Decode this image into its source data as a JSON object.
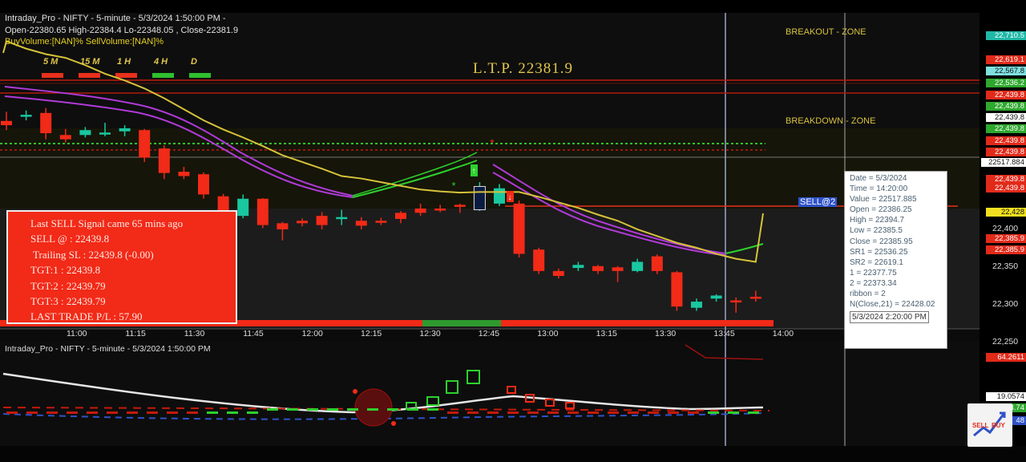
{
  "header": {
    "line1": "Intraday_Pro - NIFTY - 5-minute - 5/3/2024 1:50:00 PM -",
    "line2": "Open-22380.65  High-22384.4  Lo-22348.05 , Close-22381.9",
    "line3": "BuyVolume:[NAN]%   SellVolume:[NAN]%"
  },
  "ltp_text": "L.T.P. 22381.9",
  "zones": {
    "breakout": "BREAKOUT - ZONE",
    "breakdown": "BREAKDOWN - ZONE"
  },
  "sell_marker": "SELL@2",
  "timeframes": [
    {
      "label": "5 M",
      "color": "#e8301c"
    },
    {
      "label": "15 M",
      "color": "#e8301c"
    },
    {
      "label": "1 H",
      "color": "#e8301c"
    },
    {
      "label": "4 H",
      "color": "#2ec02e"
    },
    {
      "label": "D",
      "color": "#2ec02e"
    }
  ],
  "signal_box": {
    "line1": "Last SELL Signal came 65 mins ago",
    "line2": "SELL @ : 22439.8",
    "line3": "Trailing SL : 22439.8 (-0.00)",
    "line4": "TGT:1 : 22439.8",
    "line5": "TGT:2 : 22439.79",
    "line6": "TGT:3 : 22439.79",
    "line7": "LAST TRADE P/L : 57.90"
  },
  "tooltip": {
    "lines": [
      "Date = 5/3/2024",
      "Time = 14:20:00",
      "Value = 22517.885",
      "Open = 22386.25",
      "High = 22394.7",
      "Low = 22385.5",
      "Close = 22385.95",
      "SR1 = 22536.25",
      "SR2 = 22619.1",
      "1 = 22377.75",
      "2 = 22373.34",
      "ribbon = 2",
      "N(Close,21) = 22428.02"
    ],
    "footer": "5/3/2024 2:20:00 PM"
  },
  "price_tags": [
    {
      "text": "22,710.5",
      "color": "#1fb8a8"
    },
    {
      "text": "22,619.1",
      "color": "#e22a1a"
    },
    {
      "text": "22,567.8",
      "color": "#7fe0e0"
    },
    {
      "text": "22,536.2",
      "color": "#2ea82e"
    },
    {
      "text": "22,439.8",
      "color": "#e22a1a"
    },
    {
      "text": "22,439.8",
      "color": "#2ea82e"
    },
    {
      "text": "22,439.8",
      "color": "#ffffff"
    },
    {
      "text": "22,439.8",
      "color": "#2ea82e"
    },
    {
      "text": "22,439.8",
      "color": "#e22a1a"
    },
    {
      "text": "22,439.8",
      "color": "#e22a1a"
    },
    {
      "text": "22517.884",
      "color": "#ffffff"
    },
    {
      "text": "22,439.8",
      "color": "#e22a1a"
    },
    {
      "text": "22,439.8",
      "color": "#e22a1a"
    },
    {
      "text": "22,428",
      "color": "#f2e020"
    },
    {
      "text": "22,385.9",
      "color": "#e22a1a"
    },
    {
      "text": "22,385.9",
      "color": "#e22a1a"
    },
    {
      "text": "64.2611",
      "color": "#e22a1a"
    },
    {
      "text": "19.0574",
      "color": "#ffffff"
    },
    {
      "text": "18.74",
      "color": "#2ea82e"
    },
    {
      "text": "48",
      "color": "#2f52c8"
    }
  ],
  "y_axis_labels": [
    "22,400",
    "22,350",
    "22,300",
    "22,250"
  ],
  "indicator_header": "Intraday_Pro - NIFTY - 5-minute - 5/3/2024 1:50:00 PM",
  "colors": {
    "bull": "#19c7a0",
    "bear": "#f22a18",
    "ema": "#d6c23a",
    "ribbon_purple": "#b03ad8",
    "ribbon_green": "#2ed02e"
  },
  "chart_data": {
    "type": "candlestick",
    "categories": [
      "10:40",
      "10:45",
      "10:50",
      "10:55",
      "11:00",
      "11:05",
      "11:10",
      "11:15",
      "11:20",
      "11:25",
      "11:30",
      "11:35",
      "11:40",
      "11:45",
      "11:50",
      "11:55",
      "12:00",
      "12:05",
      "12:10",
      "12:15",
      "12:20",
      "12:25",
      "12:30",
      "12:35",
      "12:40",
      "12:45",
      "12:50",
      "12:55",
      "13:00",
      "13:05",
      "13:10",
      "13:15",
      "13:20",
      "13:25",
      "13:30",
      "13:35",
      "13:40",
      "13:45",
      "13:50"
    ],
    "x_ticks": [
      "11:00",
      "11:15",
      "11:30",
      "11:45",
      "12:00",
      "12:15",
      "12:30",
      "12:45",
      "13:00",
      "13:15",
      "13:30",
      "13:45",
      "14:00"
    ],
    "series": [
      {
        "values": [
          {
            "o": 22575,
            "h": 22590,
            "l": 22560,
            "c": 22568
          },
          {
            "o": 22582,
            "h": 22592,
            "l": 22576,
            "c": 22585
          },
          {
            "o": 22588,
            "h": 22596,
            "l": 22545,
            "c": 22555
          },
          {
            "o": 22552,
            "h": 22562,
            "l": 22540,
            "c": 22545
          },
          {
            "o": 22552,
            "h": 22565,
            "l": 22548,
            "c": 22560
          },
          {
            "o": 22555,
            "h": 22572,
            "l": 22550,
            "c": 22556
          },
          {
            "o": 22558,
            "h": 22568,
            "l": 22550,
            "c": 22563
          },
          {
            "o": 22560,
            "h": 22562,
            "l": 22508,
            "c": 22515
          },
          {
            "o": 22530,
            "h": 22535,
            "l": 22480,
            "c": 22490
          },
          {
            "o": 22492,
            "h": 22500,
            "l": 22480,
            "c": 22485
          },
          {
            "o": 22488,
            "h": 22491,
            "l": 22448,
            "c": 22455
          },
          {
            "o": 22452,
            "h": 22456,
            "l": 22412,
            "c": 22420
          },
          {
            "o": 22420,
            "h": 22455,
            "l": 22416,
            "c": 22448
          },
          {
            "o": 22448,
            "h": 22449,
            "l": 22400,
            "c": 22405
          },
          {
            "o": 22408,
            "h": 22410,
            "l": 22380,
            "c": 22398
          },
          {
            "o": 22412,
            "h": 22416,
            "l": 22403,
            "c": 22408
          },
          {
            "o": 22420,
            "h": 22426,
            "l": 22398,
            "c": 22405
          },
          {
            "o": 22415,
            "h": 22430,
            "l": 22405,
            "c": 22418
          },
          {
            "o": 22412,
            "h": 22418,
            "l": 22398,
            "c": 22404
          },
          {
            "o": 22412,
            "h": 22417,
            "l": 22405,
            "c": 22410
          },
          {
            "o": 22425,
            "h": 22428,
            "l": 22408,
            "c": 22415
          },
          {
            "o": 22432,
            "h": 22440,
            "l": 22420,
            "c": 22425
          },
          {
            "o": 22432,
            "h": 22438,
            "l": 22426,
            "c": 22430
          },
          {
            "o": 22438,
            "h": 22440,
            "l": 22425,
            "c": 22435
          },
          {
            "o": 22430,
            "h": 22475,
            "l": 22428,
            "c": 22468
          },
          {
            "o": 22440,
            "h": 22472,
            "l": 22436,
            "c": 22465
          },
          {
            "o": 22440,
            "h": 22445,
            "l": 22352,
            "c": 22358
          },
          {
            "o": 22365,
            "h": 22368,
            "l": 22325,
            "c": 22330
          },
          {
            "o": 22330,
            "h": 22334,
            "l": 22318,
            "c": 22322
          },
          {
            "o": 22335,
            "h": 22345,
            "l": 22330,
            "c": 22340
          },
          {
            "o": 22338,
            "h": 22340,
            "l": 22325,
            "c": 22330
          },
          {
            "o": 22336,
            "h": 22338,
            "l": 22312,
            "c": 22330
          },
          {
            "o": 22330,
            "h": 22350,
            "l": 22328,
            "c": 22345
          },
          {
            "o": 22354,
            "h": 22357,
            "l": 22325,
            "c": 22330
          },
          {
            "o": 22328,
            "h": 22330,
            "l": 22265,
            "c": 22272
          },
          {
            "o": 22270,
            "h": 22285,
            "l": 22265,
            "c": 22280
          },
          {
            "o": 22285,
            "h": 22292,
            "l": 22280,
            "c": 22290
          },
          {
            "o": 22282,
            "h": 22287,
            "l": 22262,
            "c": 22280
          },
          {
            "o": 22288,
            "h": 22298,
            "l": 22280,
            "c": 22285
          }
        ]
      }
    ],
    "ema_line": [
      22705,
      22693,
      22684,
      22678,
      22666,
      22652,
      22641,
      22628,
      22612,
      22594,
      22576,
      22561,
      22548,
      22534,
      22519,
      22508,
      22497,
      22485,
      22481,
      22475,
      22469,
      22463,
      22460,
      22458,
      22459,
      22459,
      22459,
      22451,
      22442,
      22433,
      22422,
      22412,
      22398,
      22387,
      22376,
      22368,
      22358,
      22350,
      22345
    ],
    "ylim": [
      22250,
      22720
    ]
  }
}
